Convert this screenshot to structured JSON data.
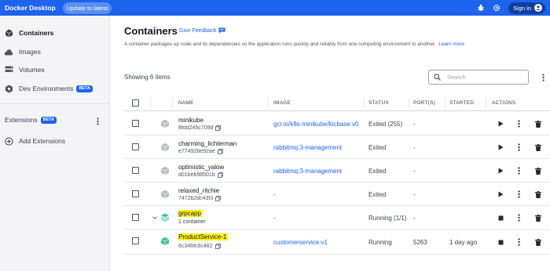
{
  "app": {
    "title": "Docker Desktop",
    "update_label": "Update to latest",
    "signin_label": "Sign in"
  },
  "sidebar": {
    "items": [
      {
        "label": "Containers",
        "icon": "containers-icon",
        "active": true
      },
      {
        "label": "Images",
        "icon": "cloud-icon"
      },
      {
        "label": "Volumes",
        "icon": "volumes-icon"
      },
      {
        "label": "Dev Environments",
        "icon": "dev-environments-icon",
        "badge": "BETA"
      }
    ],
    "extensions_label": "Extensions",
    "extensions_badge": "BETA",
    "add_extensions_label": "Add Extensions"
  },
  "main": {
    "title": "Containers",
    "feedback_label": "Give Feedback",
    "description": "A container packages up code and its dependencies so the application runs quickly and reliably from one computing environment to another.",
    "learn_more": "Learn more",
    "showing": "Showing 6 items",
    "search_placeholder": "Search"
  },
  "table": {
    "headers": {
      "name": "NAME",
      "image": "IMAGE",
      "status": "STATUS",
      "ports": "PORT(S)",
      "started": "STARTED",
      "actions": "ACTIONS"
    },
    "rows": [
      {
        "name": "minikube",
        "sub": "8fdd245c709d",
        "image": "gcr.io/k8s-minikube/kicbase:v0",
        "status": "Exited (255)",
        "ports": "-",
        "started": ""
      },
      {
        "name": "charming_lichterman",
        "sub": "e774926e92ae",
        "image": "rabbitmq:3-management",
        "status": "Exited",
        "ports": "-",
        "started": ""
      },
      {
        "name": "optimistic_yalow",
        "sub": "d01beb98501b",
        "image": "rabbitmq:3-management",
        "status": "Exited",
        "ports": "-",
        "started": ""
      },
      {
        "name": "relaxed_ritchie",
        "sub": "7472b2dc43f3",
        "image": "-",
        "status": "Exited",
        "ports": "-",
        "started": ""
      },
      {
        "name": "grpcapp",
        "sub": "1 container",
        "image": "-",
        "status": "Running (1/1)",
        "ports": "-",
        "started": ""
      },
      {
        "name": "ProductService-1",
        "sub": "6c346fc6c482",
        "image": "customerservice:v1",
        "status": "Running",
        "ports": "5263",
        "started": "1 day ago"
      }
    ]
  },
  "colors": {
    "accent": "#1d63ed",
    "highlight": "#fff31a",
    "running_cube": "#3fbf9b",
    "exited_cube": "#b8bcc4"
  }
}
